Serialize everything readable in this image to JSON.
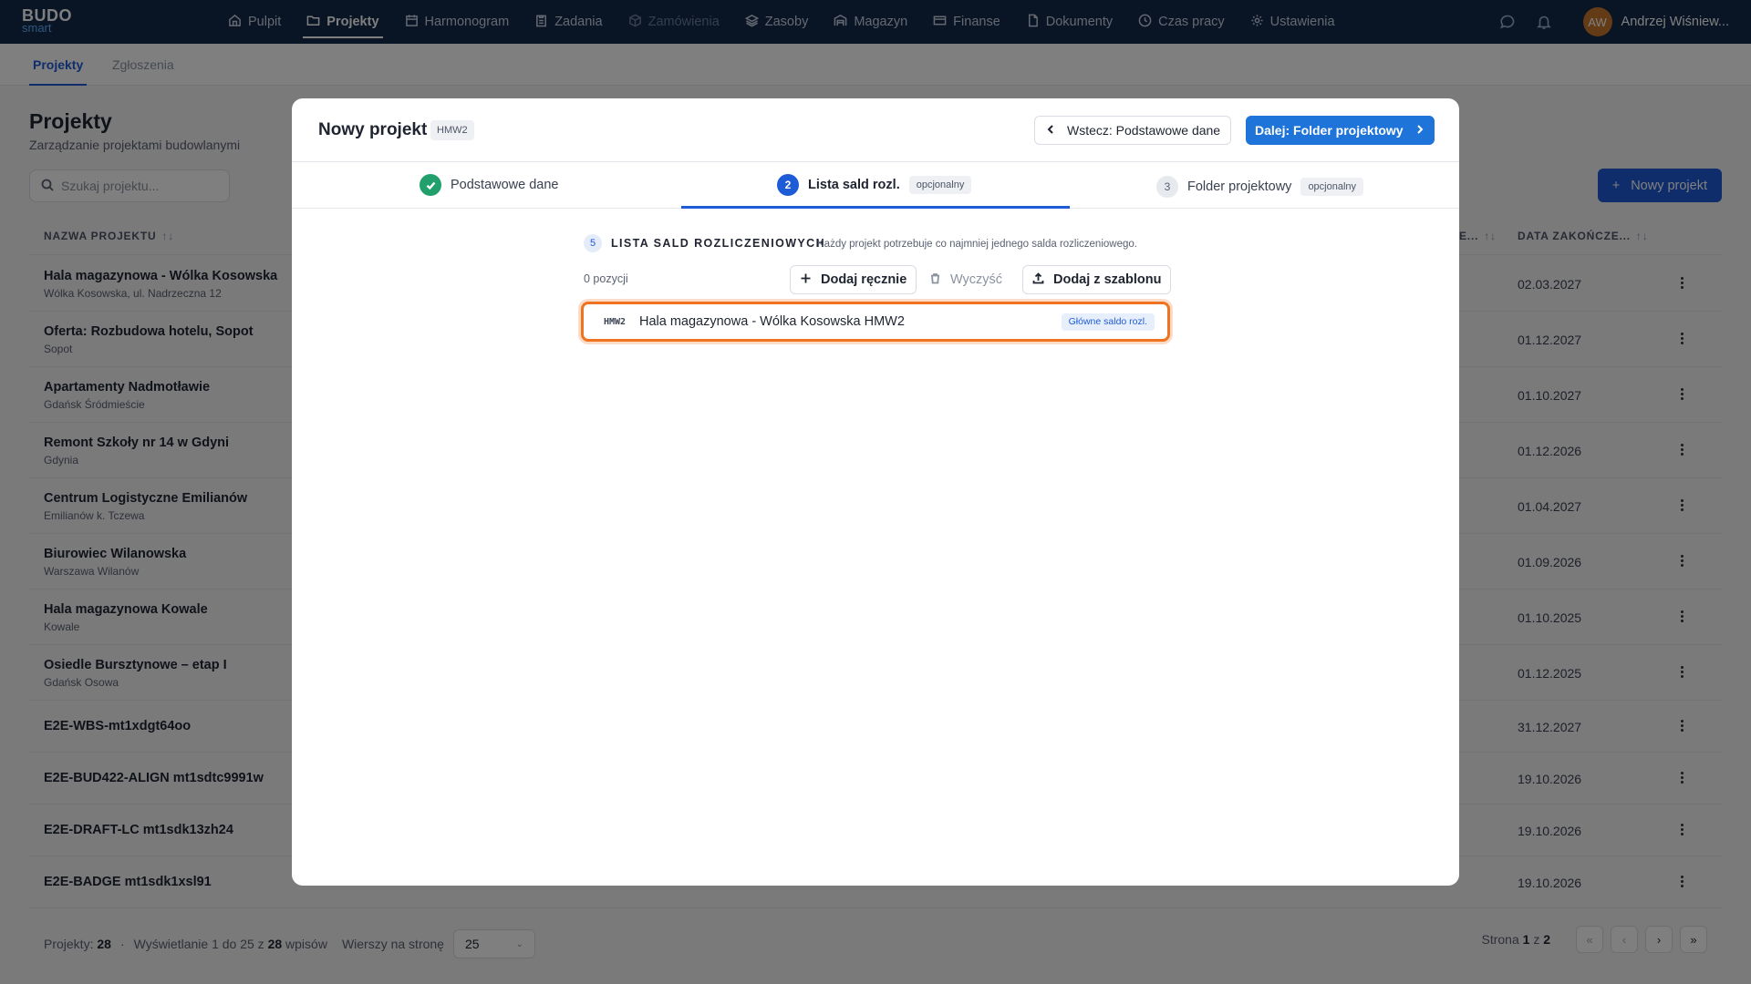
{
  "app": {
    "logo_top": "BUDO",
    "logo_bottom": "smart"
  },
  "nav": [
    {
      "label": "Pulpit",
      "icon": "home-icon",
      "state": "normal"
    },
    {
      "label": "Projekty",
      "icon": "folder-icon",
      "state": "active"
    },
    {
      "label": "Harmonogram",
      "icon": "calendar-icon",
      "state": "normal"
    },
    {
      "label": "Zadania",
      "icon": "clipboard-icon",
      "state": "normal"
    },
    {
      "label": "Zamówienia",
      "icon": "box-icon",
      "state": "disabled"
    },
    {
      "label": "Zasoby",
      "icon": "layers-icon",
      "state": "normal"
    },
    {
      "label": "Magazyn",
      "icon": "warehouse-icon",
      "state": "normal"
    },
    {
      "label": "Finanse",
      "icon": "card-icon",
      "state": "normal"
    },
    {
      "label": "Dokumenty",
      "icon": "documents-icon",
      "state": "normal"
    },
    {
      "label": "Czas pracy",
      "icon": "clock-icon",
      "state": "normal"
    },
    {
      "label": "Ustawienia",
      "icon": "gear-icon",
      "state": "normal"
    }
  ],
  "user": {
    "initials": "AW",
    "name": "Andrzej Wiśniew..."
  },
  "subtabs": [
    "Projekty",
    "Zgłoszenia"
  ],
  "page": {
    "title": "Projekty",
    "subtitle": "Zarządzanie projektami budowlanymi",
    "search_placeholder": "Szukaj projektu...",
    "new_button": "Nowy projekt"
  },
  "table": {
    "col_name": "NAZWA PROJEKTU",
    "col_mid": "E...",
    "col_end": "DATA ZAKOŃCZE...",
    "rows": [
      {
        "name": "Hala magazynowa - Wólka Kosowska",
        "loc": "Wólka Kosowska, ul. Nadrzeczna 12",
        "date": "02.03.2027"
      },
      {
        "name": "Oferta: Rozbudowa hotelu, Sopot",
        "loc": "Sopot",
        "date": "01.12.2027"
      },
      {
        "name": "Apartamenty Nadmotławie",
        "loc": "Gdańsk Śródmieście",
        "date": "01.10.2027"
      },
      {
        "name": "Remont Szkoły nr 14 w Gdyni",
        "loc": "Gdynia",
        "date": "01.12.2026"
      },
      {
        "name": "Centrum Logistyczne Emilianów",
        "loc": "Emilianów k. Tczewa",
        "date": "01.04.2027"
      },
      {
        "name": "Biurowiec Wilanowska",
        "loc": "Warszawa Wilanów",
        "date": "01.09.2026"
      },
      {
        "name": "Hala magazynowa Kowale",
        "loc": "Kowale",
        "date": "01.10.2025"
      },
      {
        "name": "Osiedle Bursztynowe – etap I",
        "loc": "Gdańsk Osowa",
        "date": "01.12.2025"
      },
      {
        "name": "E2E-WBS-mt1xdgt64oo",
        "loc": "",
        "date": "31.12.2027"
      },
      {
        "name": "E2E-BUD422-ALIGN mt1sdtc9991w",
        "loc": "",
        "date": "19.10.2026"
      },
      {
        "name": "E2E-DRAFT-LC mt1sdk13zh24",
        "loc": "",
        "date": "19.10.2026"
      },
      {
        "name": "E2E-BADGE mt1sdk1xsl91",
        "loc": "",
        "date": "19.10.2026"
      }
    ]
  },
  "footer": {
    "projects_label": "Projekty:",
    "projects_count": "28",
    "showing_prefix": "Wyświetlanie 1 do 25 z",
    "showing_total": "28",
    "showing_suffix": "wpisów",
    "per_page_label": "Wierszy na stronę",
    "per_page_value": "25",
    "page_prefix": "Strona",
    "page_current": "1",
    "page_sep": "z",
    "page_total": "2"
  },
  "modal": {
    "title": "Nowy projekt",
    "code": "HMW2",
    "back_label": "Wstecz: Podstawowe dane",
    "next_label": "Dalej: Folder projektowy",
    "steps": [
      {
        "label": "Podstawowe dane",
        "status": "done",
        "number": "1",
        "badge": ""
      },
      {
        "label": "Lista sald rozl.",
        "status": "current",
        "number": "2",
        "badge": "opcjonalny"
      },
      {
        "label": "Folder projektowy",
        "status": "todo",
        "number": "3",
        "badge": "opcjonalny"
      }
    ],
    "section": {
      "number": "5",
      "title": "LISTA SALD ROZLICZENIOWYCH",
      "hint": "Każdy projekt potrzebuje co najmniej jednego salda rozliczeniowego."
    },
    "count_label": "0 pozycji",
    "add_manual": "Dodaj ręcznie",
    "clear": "Wyczyść",
    "add_template": "Dodaj z szablonu",
    "item": {
      "code": "HMW2",
      "name": "Hala magazynowa - Wólka Kosowska HMW2",
      "badge": "Główne saldo rozl."
    },
    "highlight_color": "#f07322",
    "accent_color": "#1e5bd7"
  }
}
